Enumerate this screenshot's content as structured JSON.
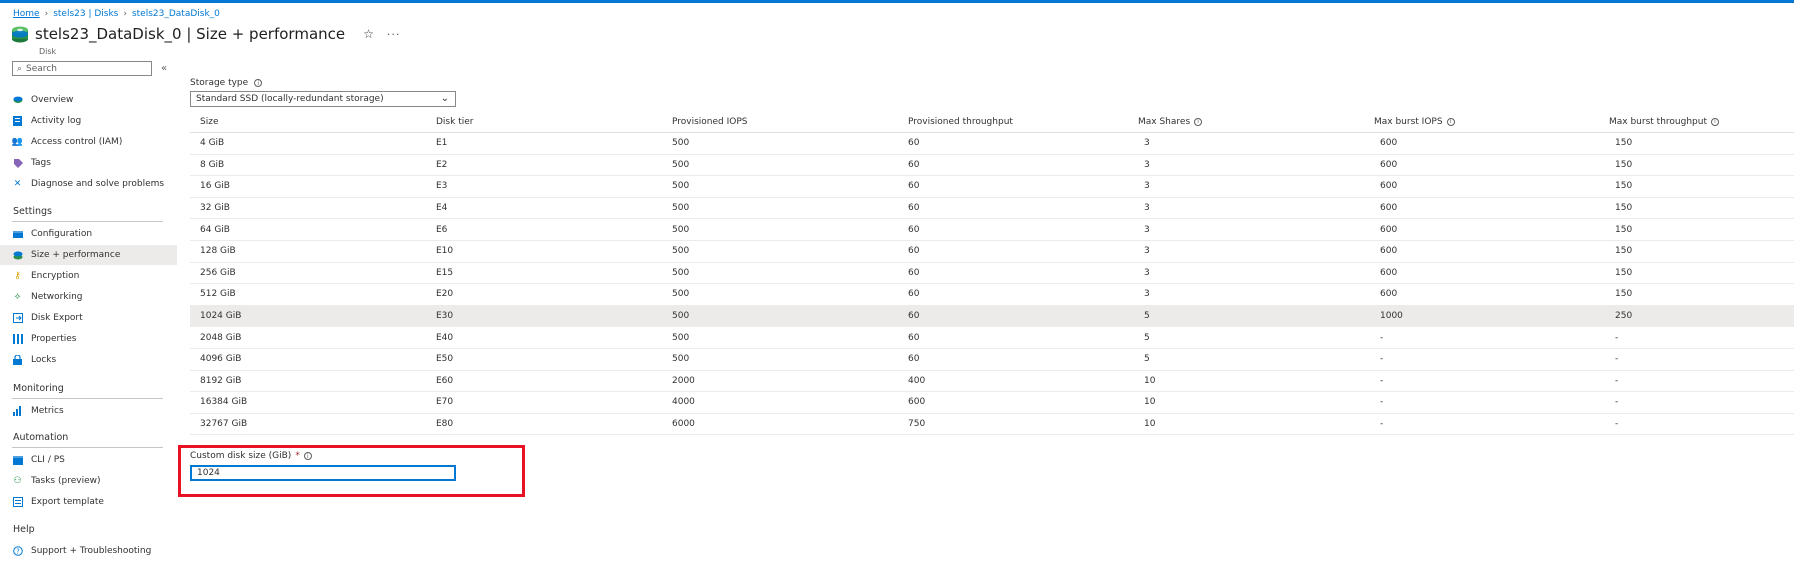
{
  "breadcrumb": {
    "home": "Home",
    "disks": "stels23 | Disks",
    "current": "stels23_DataDisk_0"
  },
  "header": {
    "title": "stels23_DataDisk_0 | Size + performance",
    "subtitle": "Disk"
  },
  "sidebar": {
    "search_placeholder": "Search",
    "items": [
      {
        "label": "Overview",
        "icon": "overview-icon"
      },
      {
        "label": "Activity log",
        "icon": "activity-log-icon"
      },
      {
        "label": "Access control (IAM)",
        "icon": "iam-icon"
      },
      {
        "label": "Tags",
        "icon": "tag-icon"
      },
      {
        "label": "Diagnose and solve problems",
        "icon": "wrench-icon"
      }
    ],
    "settings_header": "Settings",
    "settings_items": [
      {
        "label": "Configuration",
        "icon": "configuration-icon"
      },
      {
        "label": "Size + performance",
        "icon": "disk-icon"
      },
      {
        "label": "Encryption",
        "icon": "key-icon"
      },
      {
        "label": "Networking",
        "icon": "network-icon"
      },
      {
        "label": "Disk Export",
        "icon": "export-icon"
      },
      {
        "label": "Properties",
        "icon": "properties-icon"
      },
      {
        "label": "Locks",
        "icon": "lock-icon"
      }
    ],
    "monitoring_header": "Monitoring",
    "monitoring_items": [
      {
        "label": "Metrics",
        "icon": "metrics-icon"
      }
    ],
    "automation_header": "Automation",
    "automation_items": [
      {
        "label": "CLI / PS",
        "icon": "cli-icon"
      },
      {
        "label": "Tasks (preview)",
        "icon": "tasks-icon"
      },
      {
        "label": "Export template",
        "icon": "template-icon"
      }
    ],
    "help_header": "Help",
    "help_items": [
      {
        "label": "Support + Troubleshooting",
        "icon": "help-icon"
      }
    ]
  },
  "main": {
    "storage_type_label": "Storage type",
    "storage_type_value": "Standard SSD (locally-redundant storage)",
    "table": {
      "columns": [
        "Size",
        "Disk tier",
        "Provisioned IOPS",
        "Provisioned throughput",
        "Max Shares",
        "Max burst IOPS",
        "Max burst throughput"
      ],
      "rows": [
        [
          "4 GiB",
          "E1",
          "500",
          "60",
          "3",
          "600",
          "150"
        ],
        [
          "8 GiB",
          "E2",
          "500",
          "60",
          "3",
          "600",
          "150"
        ],
        [
          "16 GiB",
          "E3",
          "500",
          "60",
          "3",
          "600",
          "150"
        ],
        [
          "32 GiB",
          "E4",
          "500",
          "60",
          "3",
          "600",
          "150"
        ],
        [
          "64 GiB",
          "E6",
          "500",
          "60",
          "3",
          "600",
          "150"
        ],
        [
          "128 GiB",
          "E10",
          "500",
          "60",
          "3",
          "600",
          "150"
        ],
        [
          "256 GiB",
          "E15",
          "500",
          "60",
          "3",
          "600",
          "150"
        ],
        [
          "512 GiB",
          "E20",
          "500",
          "60",
          "3",
          "600",
          "150"
        ],
        [
          "1024 GiB",
          "E30",
          "500",
          "60",
          "5",
          "1000",
          "250"
        ],
        [
          "2048 GiB",
          "E40",
          "500",
          "60",
          "5",
          "-",
          "-"
        ],
        [
          "4096 GiB",
          "E50",
          "500",
          "60",
          "5",
          "-",
          "-"
        ],
        [
          "8192 GiB",
          "E60",
          "2000",
          "400",
          "10",
          "-",
          "-"
        ],
        [
          "16384 GiB",
          "E70",
          "4000",
          "600",
          "10",
          "-",
          "-"
        ],
        [
          "32767 GiB",
          "E80",
          "6000",
          "750",
          "10",
          "-",
          "-"
        ]
      ],
      "selected_row": 8
    },
    "custom_size_label": "Custom disk size (GiB)",
    "custom_size_required": "*",
    "custom_size_value": "1024"
  },
  "colors": {
    "accent": "#0078d4",
    "highlight_frame": "#e81123",
    "selected_row": "#edebe9"
  }
}
